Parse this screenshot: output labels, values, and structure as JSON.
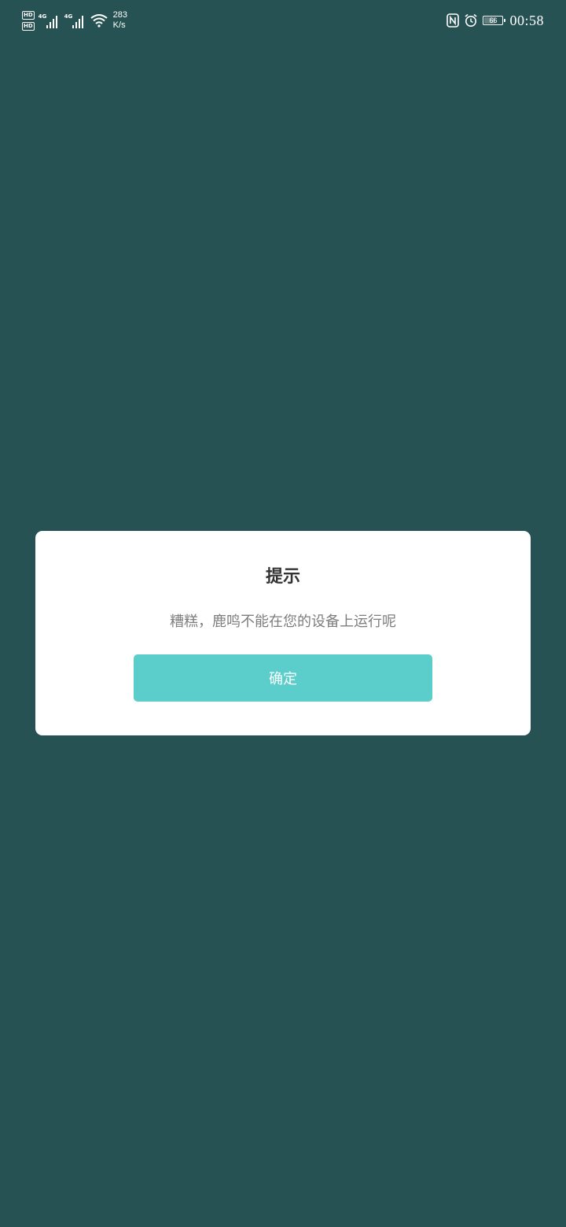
{
  "status_bar": {
    "hd_badges": [
      "HD",
      "HD"
    ],
    "sim1_network": "4G",
    "sim2_network": "4G",
    "net_speed_value": "283",
    "net_speed_unit": "K/s",
    "battery_level": "66",
    "time": "00:58",
    "icons": [
      "hd-icon",
      "signal-icon",
      "wifi-icon",
      "nfc-icon",
      "alarm-icon",
      "battery-icon"
    ]
  },
  "dialog": {
    "title": "提示",
    "message": "糟糕，鹿鸣不能在您的设备上运行呢",
    "confirm_label": "确定"
  },
  "colors": {
    "background": "#265253",
    "dialog_bg": "#ffffff",
    "title_text": "#333333",
    "message_text": "#7d7d7d",
    "button_bg": "#5bcecb",
    "button_text": "#ffffff"
  }
}
